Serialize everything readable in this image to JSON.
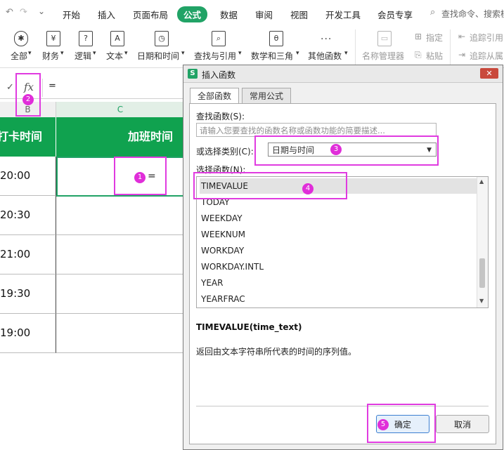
{
  "menubar": {
    "tabs": [
      "开始",
      "插入",
      "页面布局",
      "公式",
      "数据",
      "审阅",
      "视图",
      "开发工具",
      "会员专享"
    ],
    "active_tab": "公式",
    "search_text": "查找命令、搜索模"
  },
  "ribbon": {
    "groups": [
      {
        "icon": "✱",
        "label": "全部"
      },
      {
        "icon": "¥",
        "label": "财务"
      },
      {
        "icon": "?",
        "label": "逻辑"
      },
      {
        "icon": "A",
        "label": "文本"
      },
      {
        "icon": "◷",
        "label": "日期和时间"
      },
      {
        "icon": "⌕",
        "label": "查找与引用"
      },
      {
        "icon": "θ",
        "label": "数学和三角"
      },
      {
        "icon": "···",
        "label": "其他函数"
      }
    ],
    "name_manager": "名称管理器",
    "specify": "指定",
    "paste": "粘贴",
    "trace_precedents": "追踪引用",
    "trace_dependents": "追踪从属"
  },
  "formula_bar": {
    "check": "✓",
    "fx": "fx",
    "content": "="
  },
  "sheet": {
    "col_b": "B",
    "col_c": "C",
    "header_b": "打卡时间",
    "header_c": "加班时间",
    "rows": [
      "20:00",
      "20:30",
      "21:00",
      "19:30",
      "19:00"
    ],
    "active_cell_value": "="
  },
  "dialog": {
    "title": "插入函数",
    "tabs": [
      "全部函数",
      "常用公式"
    ],
    "find_label": "查找函数(S):",
    "search_placeholder": "请输入您要查找的函数名称或函数功能的简要描述...",
    "category_label": "或选择类别(C):",
    "category_value": "日期与时间",
    "select_label": "选择函数(N):",
    "functions": [
      "TIMEVALUE",
      "TODAY",
      "WEEKDAY",
      "WEEKNUM",
      "WORKDAY",
      "WORKDAY.INTL",
      "YEAR",
      "YEARFRAC"
    ],
    "selected_function": "TIMEVALUE",
    "signature": "TIMEVALUE(time_text)",
    "description": "返回由文本字符串所代表的时间的序列值。",
    "ok_label": "确定",
    "cancel_label": "取消"
  },
  "annotations": [
    "1",
    "2",
    "3",
    "4",
    "5"
  ],
  "colors": {
    "accent_green": "#21a366",
    "header_green": "#10a24f",
    "highlight_magenta": "#e03be0"
  }
}
